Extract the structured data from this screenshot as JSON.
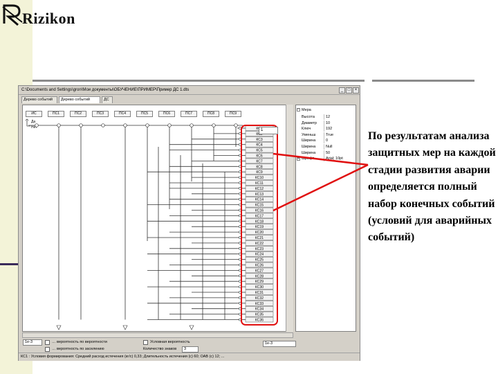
{
  "logo": {
    "text": "Rizikon"
  },
  "window": {
    "title": "C:\\Documents and Settings\\gron\\Мои документы\\ОБУЧЕНИЕ\\ПРИМЕР\\Пример ДС 1.dts",
    "tabs": [
      "Дерево событий",
      "Дерево событий",
      "ДС"
    ],
    "active_tab": 1,
    "controls": [
      "_",
      "□",
      "×"
    ]
  },
  "tree": {
    "headers": [
      "ИС",
      "ПС1",
      "ПС2",
      "ПС3",
      "ПС4",
      "ПС5",
      "ПС6",
      "ПС7",
      "ПС8",
      "ПС9"
    ],
    "axis_labels": [
      "Да",
      "Нет"
    ],
    "spin_value": "1",
    "outcomes": [
      "КС1",
      "КС2",
      "КС3",
      "КС4",
      "КС5",
      "КС6",
      "КС7",
      "КС8",
      "КС9",
      "КС10",
      "КС11",
      "КС12",
      "КС13",
      "КС14",
      "КС15",
      "КС16",
      "КС17",
      "КС18",
      "КС19",
      "КС20",
      "КС21",
      "КС22",
      "КС23",
      "КС24",
      "КС25",
      "КС26",
      "КС27",
      "КС28",
      "КС29",
      "КС30",
      "КС31",
      "КС32",
      "КС33",
      "КС34",
      "КС35",
      "КС36"
    ]
  },
  "properties": {
    "group": "Мера",
    "rows": [
      {
        "key": "Высота",
        "value": "12"
      },
      {
        "key": "Диаметр",
        "value": "10"
      },
      {
        "key": "Ключ",
        "value": "192"
      },
      {
        "key": "Уменьш",
        "value": "True"
      },
      {
        "key": "Ширина",
        "value": "0"
      },
      {
        "key": "Ширина",
        "value": "Null"
      },
      {
        "key": "Ширина",
        "value": "50"
      },
      {
        "key": "Шрифт",
        "value": "Arial; 10pt"
      }
    ]
  },
  "bottom": {
    "left_value": "1e-3",
    "checkboxes": [
      "… вероятность по вероятности",
      "… вероятность по заселению"
    ],
    "right_checkbox": "Условная вероятность",
    "count_label": "Количество знаков",
    "count_value": "3",
    "right_value": "1e-3"
  },
  "status": "КС1 : Условия формирования: Средний расход истечения (кг/с) 0,33; Длительность истечения (с) 60; ОАВ (с) 12; ...",
  "slide_text": "По результатам анализа защитных мер на каждой стадии развития аварии определяется полный набор конечных событий (условий для аварийных событий)",
  "colors": {
    "highlight": "#e01010",
    "side_band": "#f3f3d8",
    "divider": "#8a8a8a"
  }
}
